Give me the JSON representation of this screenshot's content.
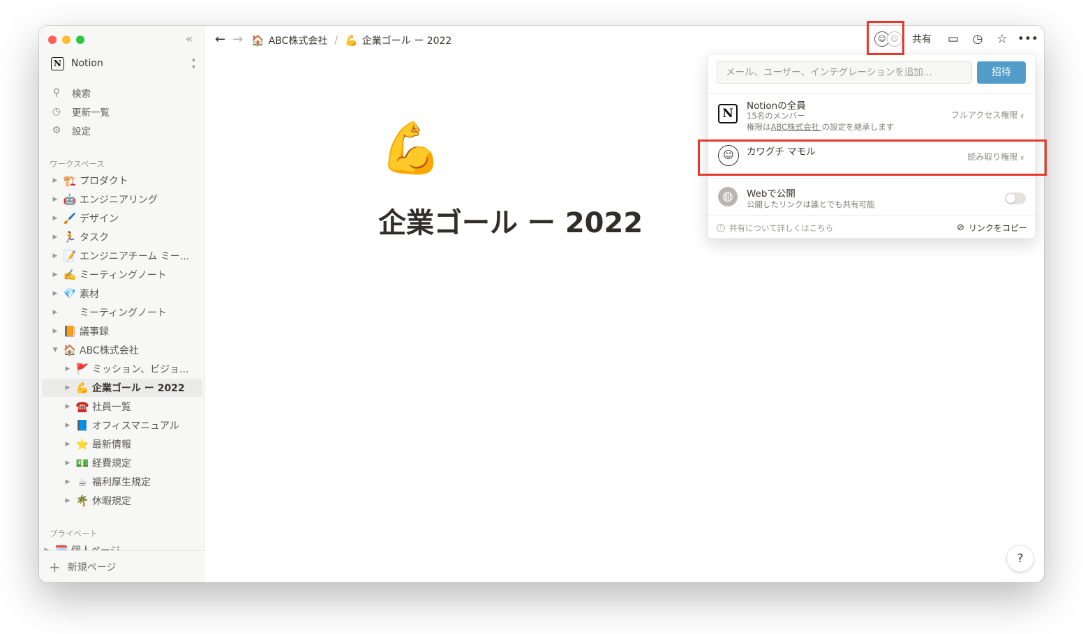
{
  "window": {
    "traffic_colors": [
      "#ff5f57",
      "#febc2e",
      "#28c840"
    ]
  },
  "sidebar": {
    "workspace_name": "Notion",
    "workspace_logo": "N",
    "nav": [
      {
        "icon": "search-icon",
        "label": "検索"
      },
      {
        "icon": "clock-icon",
        "label": "更新一覧"
      },
      {
        "icon": "gear-icon",
        "label": "設定"
      }
    ],
    "workspace_label": "ワークスペース",
    "pages": [
      {
        "emoji": "🏗️",
        "title": "プロダクト"
      },
      {
        "emoji": "🤖",
        "title": "エンジニアリング"
      },
      {
        "emoji": "🖌️",
        "title": "デザイン"
      },
      {
        "emoji": "🏃",
        "title": "タスク"
      },
      {
        "emoji": "📝",
        "title": "エンジニアチーム ミー..."
      },
      {
        "emoji": "✍️",
        "title": "ミーティングノート"
      },
      {
        "emoji": "💎",
        "title": "素材"
      },
      {
        "emoji": "",
        "title": "ミーティングノート"
      },
      {
        "emoji": "📙",
        "title": "議事録"
      },
      {
        "emoji": "🏠",
        "title": "ABC株式会社",
        "expanded": true
      },
      {
        "emoji": "🚩",
        "title": "ミッション、ビジョ...",
        "child": true
      },
      {
        "emoji": "💪",
        "title": "企業ゴール ー 2022",
        "child": true,
        "active": true
      },
      {
        "emoji": "☎️",
        "title": "社員一覧",
        "child": true
      },
      {
        "emoji": "📘",
        "title": "オフィスマニュアル",
        "child": true
      },
      {
        "emoji": "⭐",
        "title": "最新情報",
        "child": true
      },
      {
        "emoji": "💵",
        "title": "経費規定",
        "child": true
      },
      {
        "emoji": "☕",
        "title": "福利厚生規定",
        "child": true
      },
      {
        "emoji": "🌴",
        "title": "休暇規定",
        "child": true
      }
    ],
    "private_label": "プライベート",
    "private_pages": [
      {
        "emoji": "🗓️",
        "title": "個人ページ"
      }
    ],
    "new_page_label": "新規ページ"
  },
  "topbar": {
    "breadcrumb": [
      {
        "emoji": "🏠",
        "label": "ABC株式会社"
      },
      {
        "emoji": "💪",
        "label": "企業ゴール ー 2022"
      }
    ],
    "breadcrumb_sep": "/",
    "share_label": "共有"
  },
  "page": {
    "emoji": "💪",
    "title": "企業ゴール ー 2022"
  },
  "share_popup": {
    "invite_placeholder": "メール、ユーザー、インテグレーションを追加...",
    "invite_button": "招待",
    "workspace_row": {
      "name": "Notionの全員",
      "members": "15名のメンバー",
      "inherit_prefix": "権限は",
      "inherit_link": "ABC株式会社 ",
      "inherit_suffix": "の設定を継承します",
      "level": "フルアクセス権限"
    },
    "user_row": {
      "name": "カワグチ マモル",
      "level": "読み取り権限"
    },
    "web_row": {
      "title": "Webで公開",
      "desc": "公開したリンクは誰とでも共有可能",
      "enabled": false
    },
    "learn_more": "共有について詳しくはこちら",
    "copy_link": "リンクをコピー"
  },
  "help_label": "?",
  "colors": {
    "accent_blue": "#529cca",
    "highlight_red": "#e8382a"
  }
}
